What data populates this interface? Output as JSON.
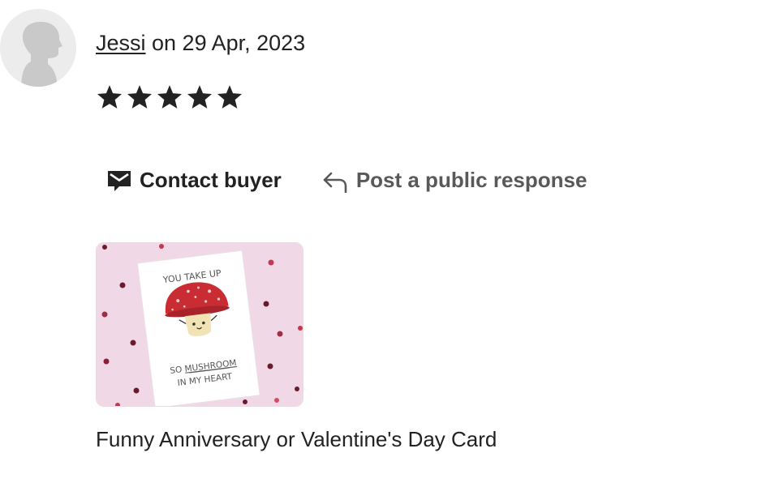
{
  "review": {
    "reviewer_name": "Jessi",
    "date_text": " on 29 Apr, 2023",
    "rating": 5,
    "max_rating": 5
  },
  "actions": {
    "contact_buyer": "Contact buyer",
    "post_public_response": "Post a public response"
  },
  "product": {
    "card_text_top": "YOU TAKE UP",
    "card_text_line2_prefix": "SO ",
    "card_text_line2_emphasis": "MUSHROOM",
    "card_text_line3": "IN MY HEART",
    "title": "Funny Anniversary or Valentine's Day Card"
  },
  "colors": {
    "text": "#222222",
    "muted_action": "#595959",
    "star": "#222222",
    "photo_background": "#f1d8e6",
    "mushroom_cap": "#c92d33"
  },
  "icons": {
    "avatar": "default-user-silhouette",
    "contact": "envelope-icon",
    "respond": "reply-arrow-icon",
    "star": "star-icon"
  }
}
